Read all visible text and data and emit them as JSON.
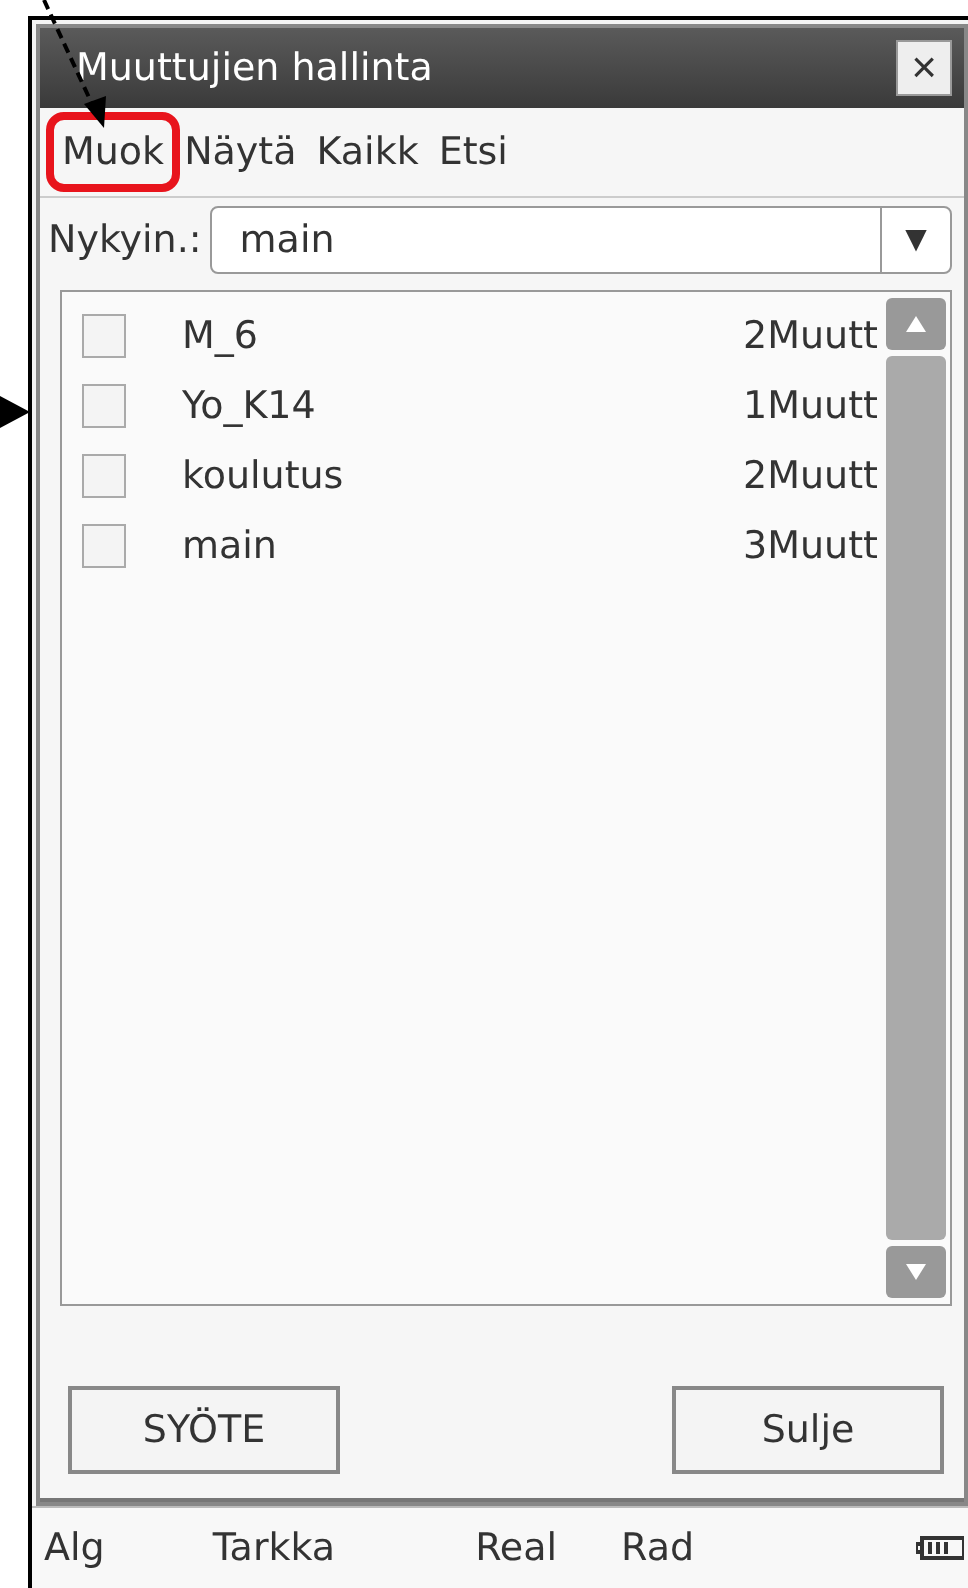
{
  "window": {
    "title": "Muuttujien hallinta",
    "close": "×"
  },
  "menu": [
    {
      "label": "Muok",
      "highlighted": true
    },
    {
      "label": "Näytä",
      "highlighted": false
    },
    {
      "label": "Kaikk",
      "highlighted": false
    },
    {
      "label": "Etsi",
      "highlighted": false
    }
  ],
  "current": {
    "label": "Nykyin.:",
    "value": "main",
    "arrow": "▼"
  },
  "folders": [
    {
      "name": "M_6",
      "count": "2Muutt",
      "checked": false
    },
    {
      "name": "Yo_K14",
      "count": "1Muutt",
      "checked": false
    },
    {
      "name": "koulutus",
      "count": "2Muutt",
      "checked": false
    },
    {
      "name": "main",
      "count": "3Muutt",
      "checked": false
    }
  ],
  "buttons": [
    "SYÖTE",
    "Sulje"
  ],
  "status_bar": [
    "Alg",
    "Tarkka",
    "Real",
    "Rad"
  ]
}
